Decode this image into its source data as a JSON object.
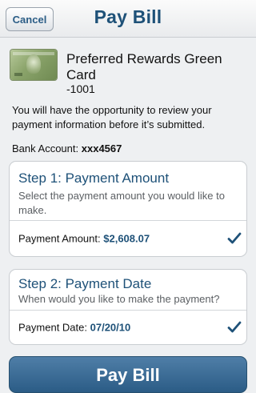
{
  "header": {
    "cancel_label": "Cancel",
    "title": "Pay Bill"
  },
  "card": {
    "name": "Preferred Rewards Green Card",
    "number": "-1001",
    "image": "green-credit-card-image"
  },
  "notice": "You will have the opportunity to review your payment information before it’s submitted.",
  "bank": {
    "label": "Bank Account:",
    "value": "xxx4567"
  },
  "step1": {
    "title": "Step 1: Payment Amount",
    "subtitle": "Select the payment amount you would like to make.",
    "field_label": "Payment Amount:",
    "field_value": "$2,608.07",
    "icon": "checkmark-icon"
  },
  "step2": {
    "title": "Step 2: Payment Date",
    "subtitle": "When would you like to make the payment?",
    "field_label": "Payment Date:",
    "field_value": "07/20/10",
    "icon": "checkmark-icon"
  },
  "pay_button_label": "Pay Bill",
  "colors": {
    "accent": "#1e5178",
    "button": "#2b5c86",
    "background": "#eef0f2"
  }
}
